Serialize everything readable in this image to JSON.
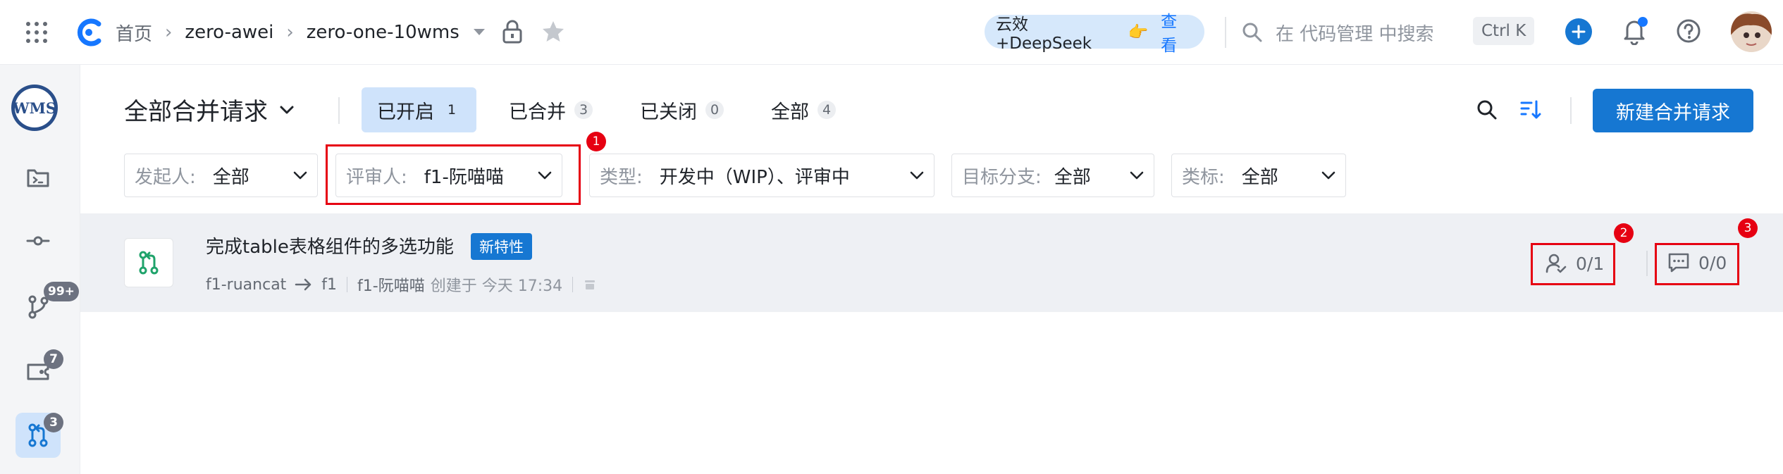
{
  "topbar": {
    "breadcrumbs": [
      "首页",
      "zero-awei",
      "zero-one-10wms"
    ],
    "ai_chip_text": "云效+DeepSeek",
    "ai_chip_emoji": "👉",
    "ai_chip_link": "查看",
    "search_placeholder": "在 代码管理 中搜索",
    "shortcut": "Ctrl K"
  },
  "rail": {
    "logo_text": "WMS",
    "badges": {
      "branches": "99+",
      "tags": "7",
      "merge_requests": "3"
    }
  },
  "main": {
    "title": "全部合并请求",
    "tabs": [
      {
        "label": "已开启",
        "count": "1",
        "active": true
      },
      {
        "label": "已合并",
        "count": "3"
      },
      {
        "label": "已关闭",
        "count": "0"
      },
      {
        "label": "全部",
        "count": "4"
      }
    ],
    "new_button": "新建合并请求"
  },
  "filters": {
    "initiator": {
      "label": "发起人:",
      "value": "全部"
    },
    "reviewer": {
      "label": "评审人:",
      "value": "f1-阮喵喵"
    },
    "type": {
      "label": "类型:",
      "value": "开发中（WIP）、评审中"
    },
    "target_branch": {
      "label": "目标分支:",
      "value": "全部"
    },
    "labels": {
      "label": "类标:",
      "value": "全部"
    }
  },
  "annotations": [
    "1",
    "2",
    "3"
  ],
  "merge_request": {
    "title": "完成table表格组件的多选功能",
    "tag": "新特性",
    "source_branch": "f1-ruancat",
    "target_branch": "f1",
    "author": "f1-阮喵喵",
    "created_text": "创建于 今天 17:34",
    "reviewers": "0/1",
    "comments": "0/0"
  },
  "colors": {
    "primary": "#1677d2",
    "annotation_red": "#e60012",
    "row_bg": "#eef0f4",
    "tab_active_bg": "#cfe3fb",
    "ai_chip_bg": "#d6e8fb"
  }
}
